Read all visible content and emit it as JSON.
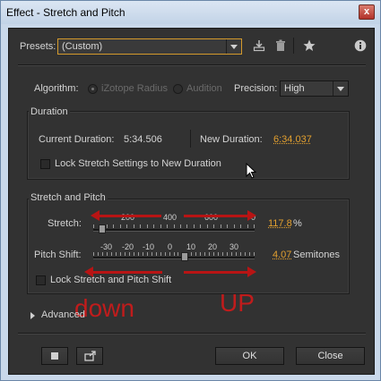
{
  "window": {
    "title": "Effect - Stretch and Pitch",
    "close_label": "x"
  },
  "presets": {
    "label": "Presets:",
    "value": "(Custom)"
  },
  "algorithm": {
    "label": "Algorithm:",
    "options": [
      "iZotope Radius",
      "Audition"
    ],
    "selected": "iZotope Radius"
  },
  "precision": {
    "label": "Precision:",
    "value": "High"
  },
  "duration": {
    "group_title": "Duration",
    "current_label": "Current Duration:",
    "current_value": "5:34.506",
    "new_label": "New Duration:",
    "new_value": "6:34.037",
    "lock_label": "Lock Stretch Settings to New Duration"
  },
  "stretch_pitch": {
    "group_title": "Stretch and Pitch",
    "stretch_label": "Stretch:",
    "stretch_ticks": [
      "200",
      "400",
      "600",
      "0"
    ],
    "stretch_value": "117.8",
    "stretch_unit": "%",
    "stretch_level_percent": 117.8,
    "pitch_label": "Pitch Shift:",
    "pitch_ticks": [
      "-30",
      "-20",
      "-10",
      "0",
      "10",
      "20",
      "30"
    ],
    "pitch_value": "4.07",
    "pitch_unit": "Semitones",
    "pitch_level_semitones": 4.07,
    "lock_label": "Lock Stretch and Pitch Shift"
  },
  "annotations": {
    "down": "down",
    "up": "UP"
  },
  "advanced": {
    "label": "Advanced"
  },
  "buttons": {
    "ok": "OK",
    "close": "Close"
  },
  "colors": {
    "accent_orange": "#e3a02f",
    "annotation_red": "#b81414"
  }
}
